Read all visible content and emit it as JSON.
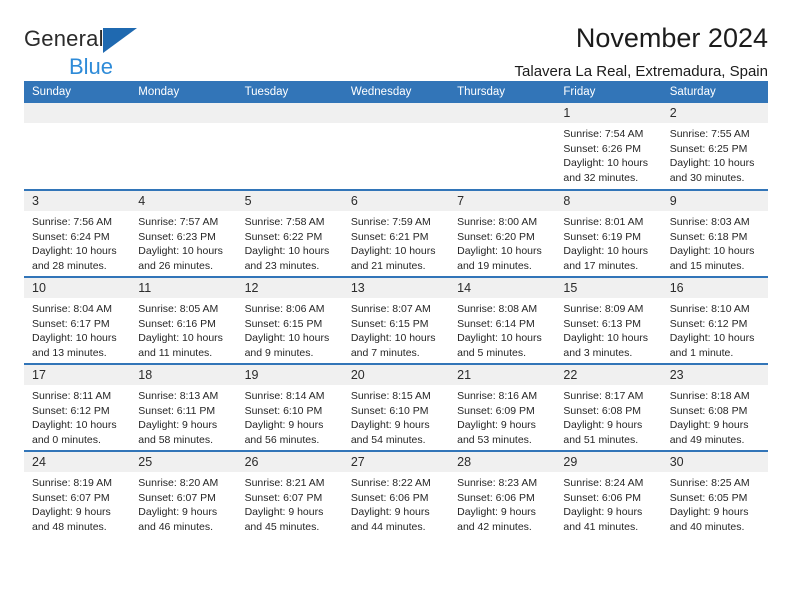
{
  "brand": {
    "name_top": "General",
    "name_bottom": "Blue",
    "accent_dark": "#1f69b0",
    "accent_light": "#2e8bd8"
  },
  "header": {
    "title": "November 2024",
    "subtitle": "Talavera La Real, Extremadura, Spain"
  },
  "calendar": {
    "header_color": "#3275b8",
    "daynum_bg": "#f0f0f0",
    "weekday_headers": [
      "Sunday",
      "Monday",
      "Tuesday",
      "Wednesday",
      "Thursday",
      "Friday",
      "Saturday"
    ],
    "weeks": [
      [
        {
          "day": "",
          "lines": []
        },
        {
          "day": "",
          "lines": []
        },
        {
          "day": "",
          "lines": []
        },
        {
          "day": "",
          "lines": []
        },
        {
          "day": "",
          "lines": []
        },
        {
          "day": "1",
          "lines": [
            "Sunrise: 7:54 AM",
            "Sunset: 6:26 PM",
            "Daylight: 10 hours",
            "and 32 minutes."
          ]
        },
        {
          "day": "2",
          "lines": [
            "Sunrise: 7:55 AM",
            "Sunset: 6:25 PM",
            "Daylight: 10 hours",
            "and 30 minutes."
          ]
        }
      ],
      [
        {
          "day": "3",
          "lines": [
            "Sunrise: 7:56 AM",
            "Sunset: 6:24 PM",
            "Daylight: 10 hours",
            "and 28 minutes."
          ]
        },
        {
          "day": "4",
          "lines": [
            "Sunrise: 7:57 AM",
            "Sunset: 6:23 PM",
            "Daylight: 10 hours",
            "and 26 minutes."
          ]
        },
        {
          "day": "5",
          "lines": [
            "Sunrise: 7:58 AM",
            "Sunset: 6:22 PM",
            "Daylight: 10 hours",
            "and 23 minutes."
          ]
        },
        {
          "day": "6",
          "lines": [
            "Sunrise: 7:59 AM",
            "Sunset: 6:21 PM",
            "Daylight: 10 hours",
            "and 21 minutes."
          ]
        },
        {
          "day": "7",
          "lines": [
            "Sunrise: 8:00 AM",
            "Sunset: 6:20 PM",
            "Daylight: 10 hours",
            "and 19 minutes."
          ]
        },
        {
          "day": "8",
          "lines": [
            "Sunrise: 8:01 AM",
            "Sunset: 6:19 PM",
            "Daylight: 10 hours",
            "and 17 minutes."
          ]
        },
        {
          "day": "9",
          "lines": [
            "Sunrise: 8:03 AM",
            "Sunset: 6:18 PM",
            "Daylight: 10 hours",
            "and 15 minutes."
          ]
        }
      ],
      [
        {
          "day": "10",
          "lines": [
            "Sunrise: 8:04 AM",
            "Sunset: 6:17 PM",
            "Daylight: 10 hours",
            "and 13 minutes."
          ]
        },
        {
          "day": "11",
          "lines": [
            "Sunrise: 8:05 AM",
            "Sunset: 6:16 PM",
            "Daylight: 10 hours",
            "and 11 minutes."
          ]
        },
        {
          "day": "12",
          "lines": [
            "Sunrise: 8:06 AM",
            "Sunset: 6:15 PM",
            "Daylight: 10 hours",
            "and 9 minutes."
          ]
        },
        {
          "day": "13",
          "lines": [
            "Sunrise: 8:07 AM",
            "Sunset: 6:15 PM",
            "Daylight: 10 hours",
            "and 7 minutes."
          ]
        },
        {
          "day": "14",
          "lines": [
            "Sunrise: 8:08 AM",
            "Sunset: 6:14 PM",
            "Daylight: 10 hours",
            "and 5 minutes."
          ]
        },
        {
          "day": "15",
          "lines": [
            "Sunrise: 8:09 AM",
            "Sunset: 6:13 PM",
            "Daylight: 10 hours",
            "and 3 minutes."
          ]
        },
        {
          "day": "16",
          "lines": [
            "Sunrise: 8:10 AM",
            "Sunset: 6:12 PM",
            "Daylight: 10 hours",
            "and 1 minute."
          ]
        }
      ],
      [
        {
          "day": "17",
          "lines": [
            "Sunrise: 8:11 AM",
            "Sunset: 6:12 PM",
            "Daylight: 10 hours",
            "and 0 minutes."
          ]
        },
        {
          "day": "18",
          "lines": [
            "Sunrise: 8:13 AM",
            "Sunset: 6:11 PM",
            "Daylight: 9 hours",
            "and 58 minutes."
          ]
        },
        {
          "day": "19",
          "lines": [
            "Sunrise: 8:14 AM",
            "Sunset: 6:10 PM",
            "Daylight: 9 hours",
            "and 56 minutes."
          ]
        },
        {
          "day": "20",
          "lines": [
            "Sunrise: 8:15 AM",
            "Sunset: 6:10 PM",
            "Daylight: 9 hours",
            "and 54 minutes."
          ]
        },
        {
          "day": "21",
          "lines": [
            "Sunrise: 8:16 AM",
            "Sunset: 6:09 PM",
            "Daylight: 9 hours",
            "and 53 minutes."
          ]
        },
        {
          "day": "22",
          "lines": [
            "Sunrise: 8:17 AM",
            "Sunset: 6:08 PM",
            "Daylight: 9 hours",
            "and 51 minutes."
          ]
        },
        {
          "day": "23",
          "lines": [
            "Sunrise: 8:18 AM",
            "Sunset: 6:08 PM",
            "Daylight: 9 hours",
            "and 49 minutes."
          ]
        }
      ],
      [
        {
          "day": "24",
          "lines": [
            "Sunrise: 8:19 AM",
            "Sunset: 6:07 PM",
            "Daylight: 9 hours",
            "and 48 minutes."
          ]
        },
        {
          "day": "25",
          "lines": [
            "Sunrise: 8:20 AM",
            "Sunset: 6:07 PM",
            "Daylight: 9 hours",
            "and 46 minutes."
          ]
        },
        {
          "day": "26",
          "lines": [
            "Sunrise: 8:21 AM",
            "Sunset: 6:07 PM",
            "Daylight: 9 hours",
            "and 45 minutes."
          ]
        },
        {
          "day": "27",
          "lines": [
            "Sunrise: 8:22 AM",
            "Sunset: 6:06 PM",
            "Daylight: 9 hours",
            "and 44 minutes."
          ]
        },
        {
          "day": "28",
          "lines": [
            "Sunrise: 8:23 AM",
            "Sunset: 6:06 PM",
            "Daylight: 9 hours",
            "and 42 minutes."
          ]
        },
        {
          "day": "29",
          "lines": [
            "Sunrise: 8:24 AM",
            "Sunset: 6:06 PM",
            "Daylight: 9 hours",
            "and 41 minutes."
          ]
        },
        {
          "day": "30",
          "lines": [
            "Sunrise: 8:25 AM",
            "Sunset: 6:05 PM",
            "Daylight: 9 hours",
            "and 40 minutes."
          ]
        }
      ]
    ]
  }
}
